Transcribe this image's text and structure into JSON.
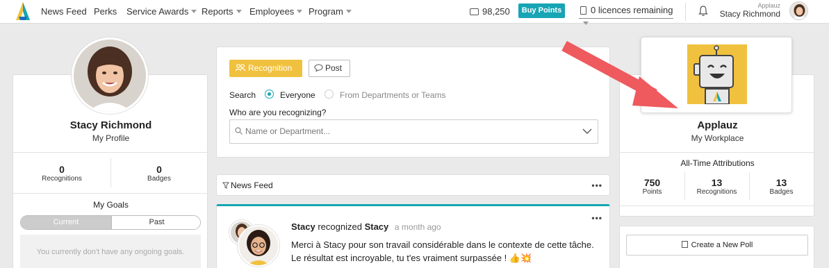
{
  "topbar": {
    "nav": [
      {
        "label": "News Feed",
        "dropdown": false
      },
      {
        "label": "Perks",
        "dropdown": false
      },
      {
        "label": "Service Awards",
        "dropdown": true
      },
      {
        "label": "Reports",
        "dropdown": true
      },
      {
        "label": "Employees",
        "dropdown": true
      },
      {
        "label": "Program",
        "dropdown": true
      }
    ],
    "points": "98,250",
    "buy_points_label": "Buy Points",
    "licences_label": "0 licences remaining",
    "company_small": "Applauz",
    "user_name": "Stacy Richmond",
    "accent_color": "#16a5b4"
  },
  "profile": {
    "name": "Stacy Richmond",
    "subtitle": "My Profile",
    "recognitions_value": "0",
    "recognitions_label": "Recognitions",
    "badges_value": "0",
    "badges_label": "Badges",
    "goals_title": "My Goals",
    "goals_tab_current": "Current",
    "goals_tab_past": "Past",
    "goals_empty": "You currently don't have any ongoing goals."
  },
  "recognition": {
    "recognition_button": "Recognition",
    "post_button": "Post",
    "search_label": "Search",
    "option_everyone": "Everyone",
    "option_departments": "From Departments or Teams",
    "who_label": "Who are you recognizing?",
    "who_placeholder": "Name or Department..."
  },
  "feed": {
    "title": "News Feed",
    "menu": "•••",
    "post": {
      "author": "Stacy",
      "verb": "recognized",
      "recipient": "Stacy",
      "time": "a month ago",
      "menu": "•••",
      "body": "Merci à Stacy pour son travail considérable dans le contexte de cette tâche. Le résultat est incroyable, tu t'es vraiment surpassée ! 👍💥"
    }
  },
  "company": {
    "name": "Applauz",
    "subtitle": "My Workplace",
    "attributions_title": "All-Time Attributions",
    "stats": [
      {
        "value": "750",
        "label": "Points"
      },
      {
        "value": "13",
        "label": "Recognitions"
      },
      {
        "value": "13",
        "label": "Badges"
      }
    ],
    "poll_button": "Create a New Poll"
  }
}
